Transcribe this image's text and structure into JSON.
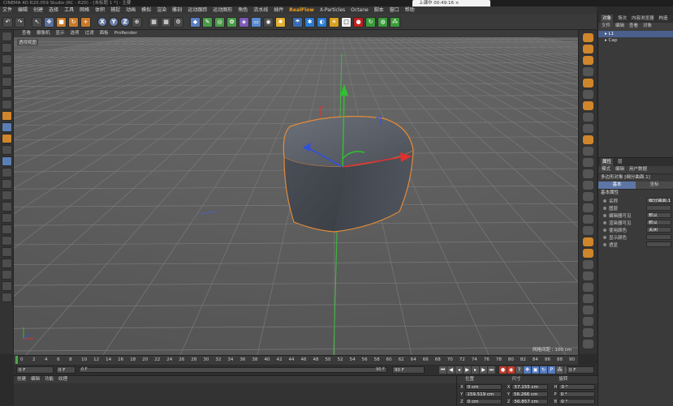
{
  "window": {
    "title": "CINEMA 4D R20.059 Studio (RC - R20) - [未标题 1 *] - 主要",
    "browser_tab": "上课中 00:49:16"
  },
  "menu": [
    "文件",
    "编辑",
    "创建",
    "选择",
    "工具",
    "网格",
    "体积",
    "捕捉",
    "动画",
    "模拟",
    "渲染",
    "雕刻",
    "运动跟踪",
    "运动图形",
    "角色",
    "流水线",
    "插件",
    "RealFlow",
    "X-Particles",
    "Octane",
    "脚本",
    "窗口",
    "帮助"
  ],
  "toolbar": {
    "x": "X",
    "y": "Y",
    "z": "Z"
  },
  "viewport": {
    "menu": [
      "查看",
      "摄像机",
      "显示",
      "选项",
      "过滤",
      "面板",
      "ProRender"
    ],
    "label": "透视视图",
    "grid_spacing": "网格间距 : 100 cm"
  },
  "object_manager": {
    "tabs": [
      "对象",
      "场次",
      "内容浏览器",
      "构造"
    ],
    "menu": [
      "文件",
      "编辑",
      "查看",
      "对象"
    ],
    "objects": [
      {
        "name": "L1",
        "selected": true
      },
      {
        "name": "Cap",
        "selected": false
      }
    ]
  },
  "attribute_manager": {
    "tabs": [
      "属性",
      "层"
    ],
    "menu": [
      "模式",
      "编辑",
      "用户数据"
    ],
    "object_label": "多边形对象 [细分曲面.1]",
    "subtabs": [
      "基本",
      "坐标"
    ],
    "section": "基本属性",
    "props": [
      {
        "label": "名称",
        "value": "细分曲面.1"
      },
      {
        "label": "图层",
        "value": ""
      },
      {
        "label": "编辑器可见",
        "value": "默认"
      },
      {
        "label": "渲染器可见",
        "value": "默认"
      },
      {
        "label": "使用颜色",
        "value": "关闭"
      },
      {
        "label": "显示颜色",
        "value": ""
      },
      {
        "label": "透显",
        "value": ""
      }
    ]
  },
  "timeline": {
    "ticks": [
      "0",
      "2",
      "4",
      "6",
      "8",
      "10",
      "12",
      "14",
      "16",
      "18",
      "20",
      "22",
      "24",
      "26",
      "28",
      "30",
      "32",
      "34",
      "36",
      "38",
      "40",
      "42",
      "44",
      "46",
      "48",
      "50",
      "52",
      "54",
      "56",
      "58",
      "60",
      "62",
      "64",
      "66",
      "68",
      "70",
      "72",
      "74",
      "76",
      "78",
      "80",
      "82",
      "84",
      "86",
      "88",
      "90"
    ],
    "current_frame": "0 F",
    "start_frame": "0 F",
    "range_start": "0 F",
    "range_end": "90 F",
    "end_frame": "90 F",
    "frame_counter": "0 F"
  },
  "material_manager": {
    "menu": [
      "创建",
      "编辑",
      "功能",
      "纹理"
    ]
  },
  "coordinates": {
    "headers": [
      "位置",
      "尺寸",
      "旋转"
    ],
    "rows": [
      {
        "pos_k": "X",
        "pos": "0 cm",
        "size_k": "X",
        "size": "57.155 cm",
        "rot_k": "H",
        "rot": "0 °"
      },
      {
        "pos_k": "Y",
        "pos": "159.519 cm",
        "size_k": "Y",
        "size": "56.266 cm",
        "rot_k": "P",
        "rot": "0 °"
      },
      {
        "pos_k": "Z",
        "pos": "0 cm",
        "size_k": "Z",
        "size": "56.857 cm",
        "rot_k": "B",
        "rot": "0 °"
      }
    ]
  },
  "colors": {
    "accent_orange": "#d0862b",
    "selection_blue": "#4b5f8c",
    "axis_x": "#e03030",
    "axis_y": "#30c030",
    "axis_z": "#3050e0"
  }
}
